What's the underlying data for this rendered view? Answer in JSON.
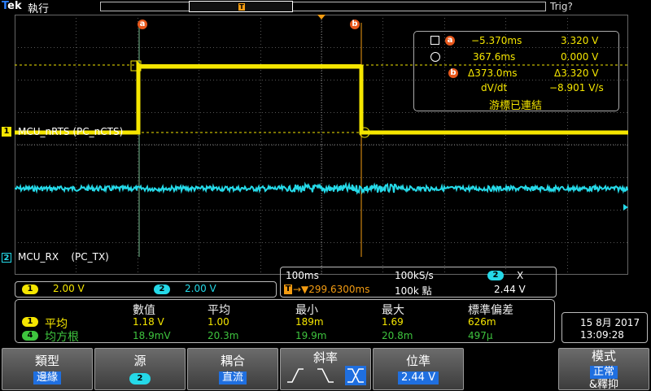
{
  "top": {
    "brand_prefix": "T",
    "brand_rest": "ek",
    "brand_sub": "執行",
    "trigger_status": "Trig?",
    "record_trigger_mark": "T"
  },
  "markers": {
    "a": "a",
    "b": "b"
  },
  "channels": {
    "ch1": {
      "num": "1",
      "label": "MCU_nRTS (PC_nCTS)",
      "color": "#f5e600"
    },
    "ch2": {
      "num": "2",
      "label": "MCU_RX    (PC_TX)",
      "color": "#25d9e8"
    },
    "ch4": {
      "num": "4",
      "color": "#3ec43e"
    }
  },
  "cursor_panel": {
    "a_time": "−5.370ms",
    "a_volt": "3.320 V",
    "b_time": "367.6ms",
    "b_volt": "0.000 V",
    "delta_time": "Δ373.0ms",
    "delta_volt": "Δ3.320 V",
    "dvdt_label": "dV/dt",
    "dvdt_value": "−8.901 V/s",
    "linked": "游標已連結"
  },
  "vertical": {
    "ch1_scale": "2.00 V",
    "ch2_scale": "2.00 V"
  },
  "horizontal": {
    "time_scale": "100ms",
    "sample_rate": "100kS/s",
    "trig_source": "2",
    "trig_slope_glyph": "X",
    "trig_delay_icon": "T",
    "trig_delay": "→▼299.6300ms",
    "record_length": "100k 點",
    "trig_level": "2.44 V"
  },
  "measurements": {
    "headers": [
      "數值",
      "平均",
      "最小",
      "最大",
      "標準偏差"
    ],
    "rows": [
      {
        "ch": "1",
        "name": "平均",
        "values": [
          "1.18 V",
          "1.00",
          "189m",
          "1.69",
          "626m"
        ]
      },
      {
        "ch": "4",
        "name": "均方根",
        "values": [
          "18.9mV",
          "20.3m",
          "19.9m",
          "20.8m",
          "497μ"
        ]
      }
    ]
  },
  "datetime": {
    "date": "15 8月 2017",
    "time": "13:09:28"
  },
  "menu": {
    "type": {
      "title": "類型",
      "value": "邊緣"
    },
    "source": {
      "title": "源",
      "value": "2"
    },
    "coupling": {
      "title": "耦合",
      "value": "直流"
    },
    "slope": {
      "title": "斜率"
    },
    "level": {
      "title": "位準",
      "value": "2.44 V"
    },
    "mode": {
      "title": "模式",
      "value": "正常",
      "extra": "&釋抑"
    }
  }
}
